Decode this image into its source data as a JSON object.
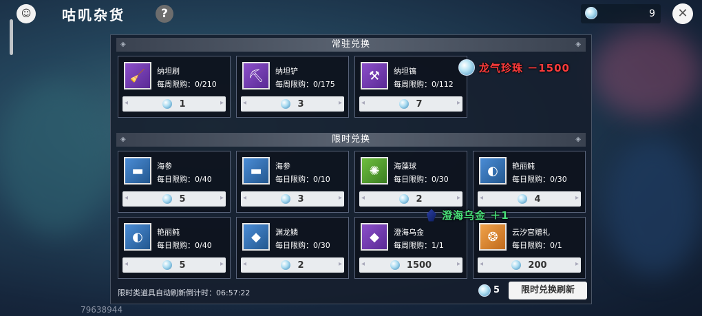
{
  "header": {
    "title": "咕叽杂货",
    "help_label": "?",
    "currency_count": "9",
    "close_label": "✕"
  },
  "sections": {
    "permanent_title": "常驻兑换",
    "limited_title": "限时兑换"
  },
  "permanent_items": [
    {
      "name": "纳坦刷",
      "limit": "每周限购：0/210",
      "price": "1",
      "icon": "brush-icon"
    },
    {
      "name": "纳坦铲",
      "limit": "每周限购：0/175",
      "price": "3",
      "icon": "shovel-icon"
    },
    {
      "name": "纳坦镐",
      "limit": "每周限购：0/112",
      "price": "7",
      "icon": "pickaxe-icon"
    }
  ],
  "limited_items": [
    {
      "name": "海参",
      "limit": "每日限购：0/40",
      "price": "5",
      "icon": "sea-cucumber-icon"
    },
    {
      "name": "海参",
      "limit": "每日限购：0/10",
      "price": "3",
      "icon": "sea-cucumber-icon"
    },
    {
      "name": "海藻球",
      "limit": "每日限购：0/30",
      "price": "2",
      "icon": "seaweed-ball-icon"
    },
    {
      "name": "艳丽鲀",
      "limit": "每日限购：0/30",
      "price": "4",
      "icon": "pufferfish-icon"
    },
    {
      "name": "艳丽鲀",
      "limit": "每日限购：0/40",
      "price": "5",
      "icon": "pufferfish-icon"
    },
    {
      "name": "渊龙鳞",
      "limit": "每日限购：0/30",
      "price": "2",
      "icon": "dragon-scale-icon"
    },
    {
      "name": "澄海乌金",
      "limit": "每周限购：1/1",
      "price": "1500",
      "icon": "black-gold-icon"
    },
    {
      "name": "云汐宫赠礼",
      "limit": "每日限购：0/1",
      "price": "200",
      "icon": "gift-shell-icon"
    }
  ],
  "footer": {
    "countdown_label": "限时类道具自动刷新倒计时：06:57:22",
    "refresh_cost": "5",
    "refresh_label": "限时兑换刷新"
  },
  "floating": {
    "cost_text": "龙气珍珠 －1500",
    "gain_text": "澄海乌金 ＋1"
  },
  "uid": "79638944",
  "colors": {
    "cost_red": "#ff3b3b",
    "gain_green": "#49e07a"
  }
}
